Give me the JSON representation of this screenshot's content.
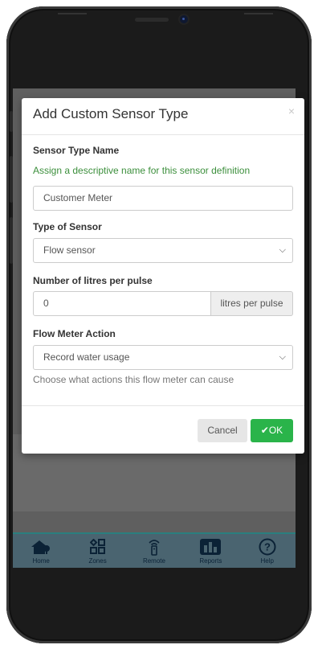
{
  "modal": {
    "title": "Add Custom Sensor Type",
    "close_glyph": "×",
    "sensor_name": {
      "label": "Sensor Type Name",
      "help": "Assign a descriptive name for this sensor definition",
      "value": "Customer Meter"
    },
    "sensor_type": {
      "label": "Type of Sensor",
      "selected": "Flow sensor"
    },
    "litres": {
      "label": "Number of litres per pulse",
      "value": "0",
      "addon": "litres per pulse"
    },
    "action": {
      "label": "Flow Meter Action",
      "selected": "Record water usage",
      "help": "Choose what actions this flow meter can cause"
    },
    "buttons": {
      "cancel": "Cancel",
      "ok": "✔OK"
    }
  },
  "bottom_nav": [
    {
      "label": "Home",
      "icon": "home-icon"
    },
    {
      "label": "Zones",
      "icon": "zones-icon"
    },
    {
      "label": "Remote",
      "icon": "remote-icon"
    },
    {
      "label": "Reports",
      "icon": "reports-icon"
    },
    {
      "label": "Help",
      "icon": "help-icon"
    }
  ],
  "colors": {
    "accent_green": "#2ab44a",
    "help_green": "#3c8f3c",
    "nav_bg": "#4a6470",
    "overlay": "#5f5f5f"
  }
}
